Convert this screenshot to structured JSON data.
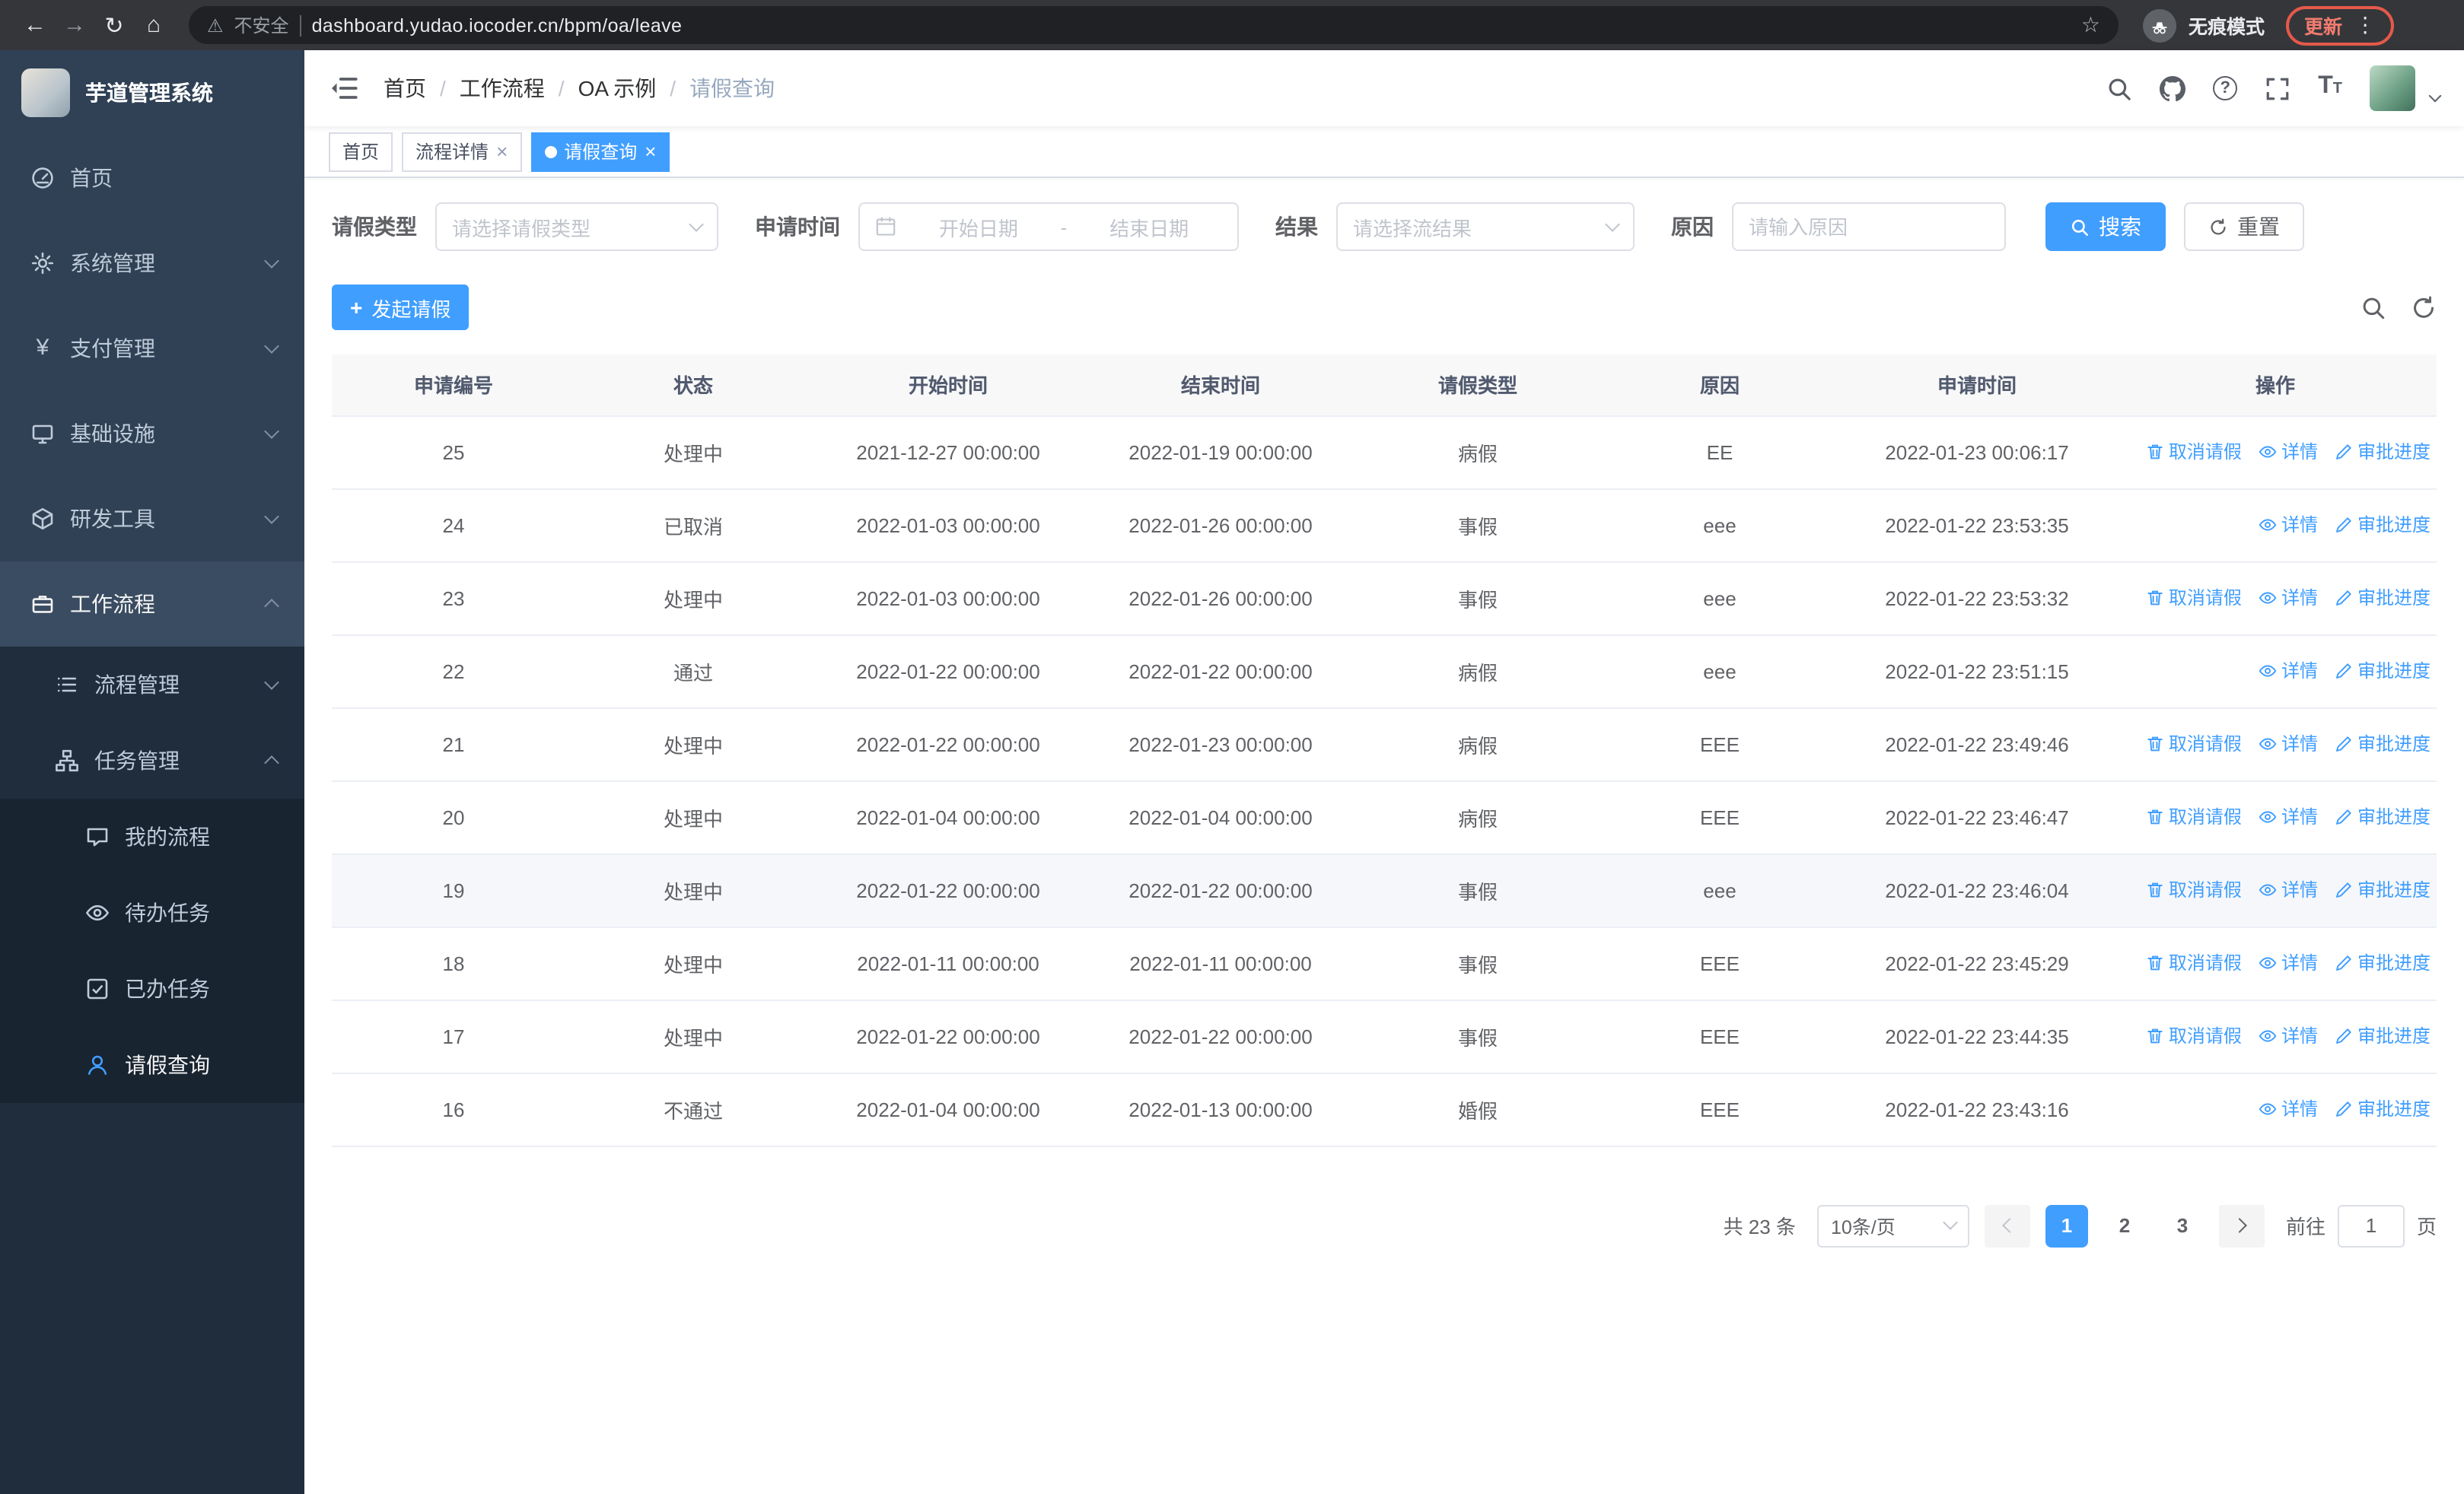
{
  "theme": {
    "primary": "#409eff",
    "sidebar_bg": "#304156",
    "sidebar_submenu_bg": "#1f2d3d",
    "sidebar_text": "#bfcbd9",
    "header_bg": "#f8f8f9",
    "link": "#409eff",
    "update_red": "#e5594a"
  },
  "icons": {
    "back": "←",
    "forward": "→",
    "reload": "↻",
    "home": "⌂",
    "warning": "⚠",
    "star": "☆",
    "kebab": "⋮",
    "close": "×",
    "yen": "¥",
    "question": "?",
    "plus": "+",
    "font_big": "T",
    "font_small": "T"
  },
  "browser": {
    "security_warning": "不安全",
    "url": "dashboard.yudao.iocoder.cn/bpm/oa/leave",
    "incognito_label": "无痕模式",
    "update_label": "更新"
  },
  "sidebar": {
    "app_title": "芋道管理系统",
    "items": [
      {
        "label": "首页"
      },
      {
        "label": "系统管理"
      },
      {
        "label": "支付管理"
      },
      {
        "label": "基础设施"
      },
      {
        "label": "研发工具"
      },
      {
        "label": "工作流程"
      }
    ],
    "workflow_children": [
      {
        "label": "流程管理"
      },
      {
        "label": "任务管理"
      }
    ],
    "task_children": [
      {
        "label": "我的流程"
      },
      {
        "label": "待办任务"
      },
      {
        "label": "已办任务"
      },
      {
        "label": "请假查询"
      }
    ]
  },
  "header": {
    "breadcrumb": {
      "separator": "/",
      "items": [
        "首页",
        "工作流程",
        "OA 示例",
        "请假查询"
      ]
    }
  },
  "tabs": [
    {
      "label": "首页"
    },
    {
      "label": "流程详情"
    },
    {
      "label": "请假查询"
    }
  ],
  "filters": {
    "leave_type_label": "请假类型",
    "leave_type_placeholder": "请选择请假类型",
    "apply_time_label": "申请时间",
    "start_date_placeholder": "开始日期",
    "range_separator": "-",
    "end_date_placeholder": "结束日期",
    "result_label": "结果",
    "result_placeholder": "请选择流结果",
    "reason_label": "原因",
    "reason_placeholder": "请输入原因",
    "search_label": "搜索",
    "reset_label": "重置"
  },
  "toolbar": {
    "create_label": "发起请假"
  },
  "table": {
    "columns": [
      "申请编号",
      "状态",
      "开始时间",
      "结束时间",
      "请假类型",
      "原因",
      "申请时间",
      "操作"
    ],
    "rows": [
      {
        "id": "25",
        "status": "处理中",
        "start": "2021-12-27 00:00:00",
        "end": "2022-01-19 00:00:00",
        "type": "病假",
        "reason": "EE",
        "applied": "2022-01-23 00:06:17",
        "show_cancel": true,
        "highlighted": false
      },
      {
        "id": "24",
        "status": "已取消",
        "start": "2022-01-03 00:00:00",
        "end": "2022-01-26 00:00:00",
        "type": "事假",
        "reason": "eee",
        "applied": "2022-01-22 23:53:35",
        "show_cancel": false,
        "highlighted": false
      },
      {
        "id": "23",
        "status": "处理中",
        "start": "2022-01-03 00:00:00",
        "end": "2022-01-26 00:00:00",
        "type": "事假",
        "reason": "eee",
        "applied": "2022-01-22 23:53:32",
        "show_cancel": true,
        "highlighted": false
      },
      {
        "id": "22",
        "status": "通过",
        "start": "2022-01-22 00:00:00",
        "end": "2022-01-22 00:00:00",
        "type": "病假",
        "reason": "eee",
        "applied": "2022-01-22 23:51:15",
        "show_cancel": false,
        "highlighted": false
      },
      {
        "id": "21",
        "status": "处理中",
        "start": "2022-01-22 00:00:00",
        "end": "2022-01-23 00:00:00",
        "type": "病假",
        "reason": "EEE",
        "applied": "2022-01-22 23:49:46",
        "show_cancel": true,
        "highlighted": false
      },
      {
        "id": "20",
        "status": "处理中",
        "start": "2022-01-04 00:00:00",
        "end": "2022-01-04 00:00:00",
        "type": "病假",
        "reason": "EEE",
        "applied": "2022-01-22 23:46:47",
        "show_cancel": true,
        "highlighted": false
      },
      {
        "id": "19",
        "status": "处理中",
        "start": "2022-01-22 00:00:00",
        "end": "2022-01-22 00:00:00",
        "type": "事假",
        "reason": "eee",
        "applied": "2022-01-22 23:46:04",
        "show_cancel": true,
        "highlighted": true
      },
      {
        "id": "18",
        "status": "处理中",
        "start": "2022-01-11 00:00:00",
        "end": "2022-01-11 00:00:00",
        "type": "事假",
        "reason": "EEE",
        "applied": "2022-01-22 23:45:29",
        "show_cancel": true,
        "highlighted": false
      },
      {
        "id": "17",
        "status": "处理中",
        "start": "2022-01-22 00:00:00",
        "end": "2022-01-22 00:00:00",
        "type": "事假",
        "reason": "EEE",
        "applied": "2022-01-22 23:44:35",
        "show_cancel": true,
        "highlighted": false
      },
      {
        "id": "16",
        "status": "不通过",
        "start": "2022-01-04 00:00:00",
        "end": "2022-01-13 00:00:00",
        "type": "婚假",
        "reason": "EEE",
        "applied": "2022-01-22 23:43:16",
        "show_cancel": false,
        "highlighted": false
      }
    ]
  },
  "actions": {
    "cancel": "取消请假",
    "detail": "详情",
    "progress": "审批进度"
  },
  "pagination": {
    "total_text": "共 23 条",
    "page_size": "10条/页",
    "pages": [
      "1",
      "2",
      "3"
    ],
    "active_page": "1",
    "goto_label": "前往",
    "goto_value": "1",
    "page_label": "页"
  }
}
